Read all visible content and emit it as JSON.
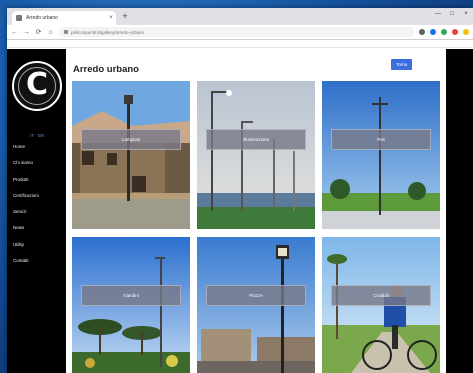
{
  "browser": {
    "tab_title": "Arredo urbano",
    "new_tab": "+",
    "tab_close": "×",
    "window_controls": [
      "—",
      "□",
      "×"
    ],
    "url": "peliconpuntit.it/gallery/arredo-urbano",
    "nav": {
      "back": "←",
      "forward": "→",
      "reload": "⟳",
      "home": "⌂"
    },
    "extension_colors": [
      "#5f6368",
      "#1a73e8",
      "#34a853",
      "#ea4335",
      "#fbbc04"
    ]
  },
  "sidebar": {
    "languages": [
      "IT",
      "EN"
    ],
    "menu": [
      "Home",
      "Chi siamo",
      "Prodotti",
      "Certificazioni",
      "Servizi",
      "News",
      "Utility",
      "Contatti"
    ]
  },
  "page": {
    "title": "Arredo urbano",
    "top_button": "Torna"
  },
  "gallery": {
    "tiles": [
      {
        "label": "Lampioni",
        "scene": "village"
      },
      {
        "label": "Illuminazione",
        "scene": "streetlight"
      },
      {
        "label": "Pali",
        "scene": "pole"
      },
      {
        "label": "Giardini",
        "scene": "trees"
      },
      {
        "label": "Piazze",
        "scene": "lamp"
      },
      {
        "label": "Ciclabili",
        "scene": "cyclist"
      }
    ]
  }
}
